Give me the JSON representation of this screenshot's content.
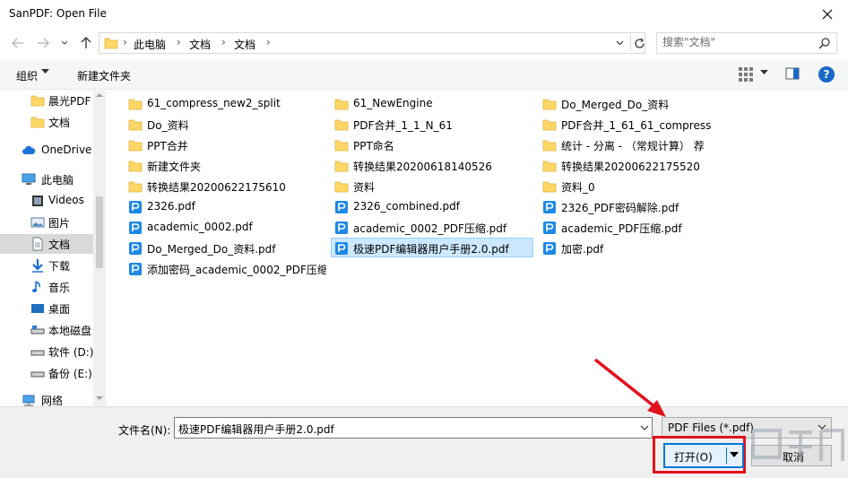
{
  "window": {
    "title": "SanPDF: Open File"
  },
  "nav": {
    "breadcrumb": [
      "此电脑",
      "文档",
      "文档"
    ],
    "search_placeholder": "搜索\"文档\""
  },
  "toolbar": {
    "organize": "组织",
    "new_folder": "新建文件夹",
    "help": "?"
  },
  "sidebar": {
    "items": [
      {
        "label": "晨光PDF",
        "icon": "folder-icon"
      },
      {
        "label": "文档",
        "icon": "folder-icon"
      },
      {
        "label": "OneDrive",
        "icon": "cloud-icon"
      },
      {
        "label": "此电脑",
        "icon": "computer-icon"
      },
      {
        "label": "Videos",
        "icon": "video-icon"
      },
      {
        "label": "图片",
        "icon": "pictures-icon"
      },
      {
        "label": "文档",
        "icon": "documents-icon",
        "selected": true
      },
      {
        "label": "下载",
        "icon": "download-icon"
      },
      {
        "label": "音乐",
        "icon": "music-icon"
      },
      {
        "label": "桌面",
        "icon": "desktop-icon"
      },
      {
        "label": "本地磁盘",
        "icon": "drive-icon"
      },
      {
        "label": "软件 (D:)",
        "icon": "drive-icon"
      },
      {
        "label": "备份 (E:)",
        "icon": "drive-icon"
      },
      {
        "label": "网络",
        "icon": "network-icon"
      }
    ]
  },
  "files": {
    "col1": [
      {
        "name": "61_compress_new2_split",
        "type": "folder"
      },
      {
        "name": "Do_资料",
        "type": "folder"
      },
      {
        "name": "PPT合并",
        "type": "folder"
      },
      {
        "name": "新建文件夹",
        "type": "folder"
      },
      {
        "name": "转换结果20200622175610",
        "type": "folder"
      },
      {
        "name": "2326.pdf",
        "type": "pdf"
      },
      {
        "name": "academic_0002.pdf",
        "type": "pdf"
      },
      {
        "name": "Do_Merged_Do_资料.pdf",
        "type": "pdf"
      },
      {
        "name": "添加密码_academic_0002_PDF压缩...",
        "type": "pdf"
      }
    ],
    "col2": [
      {
        "name": "61_NewEngine",
        "type": "folder"
      },
      {
        "name": "PDF合并_1_1_N_61",
        "type": "folder"
      },
      {
        "name": "PPT命名",
        "type": "folder"
      },
      {
        "name": "转换结果20200618140526",
        "type": "folder"
      },
      {
        "name": "资料",
        "type": "folder"
      },
      {
        "name": "2326_combined.pdf",
        "type": "pdf"
      },
      {
        "name": "academic_0002_PDF压缩.pdf",
        "type": "pdf"
      },
      {
        "name": "极速PDF编辑器用户手册2.0.pdf",
        "type": "pdf",
        "selected": true
      }
    ],
    "col3": [
      {
        "name": "Do_Merged_Do_资料",
        "type": "folder"
      },
      {
        "name": "PDF合并_1_61_61_compress",
        "type": "folder"
      },
      {
        "name": "统计 - 分离 - （常规计算） 荐",
        "type": "folder"
      },
      {
        "name": "转换结果20200622175520",
        "type": "folder"
      },
      {
        "name": "资料_0",
        "type": "folder"
      },
      {
        "name": "2326_PDF密码解除.pdf",
        "type": "pdf"
      },
      {
        "name": "academic_PDF压缩.pdf",
        "type": "pdf"
      },
      {
        "name": "加密.pdf",
        "type": "pdf"
      }
    ]
  },
  "bottom": {
    "filename_label": "文件名(N):",
    "filename_value": "极速PDF编辑器用户手册2.0.pdf",
    "filetype": "PDF Files (*.pdf)",
    "open_label": "打开(O)",
    "cancel_label": "取消"
  },
  "colors": {
    "accent": "#0078d7",
    "highlight": "#e3111d",
    "folder": "#ffd767",
    "pdf": "#1e88e5"
  }
}
